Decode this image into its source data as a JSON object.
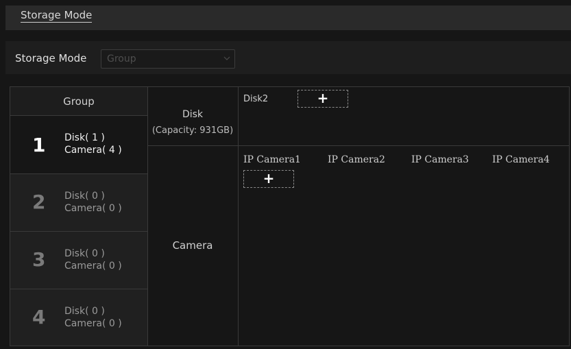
{
  "tab": {
    "label": "Storage Mode"
  },
  "storage_mode": {
    "label": "Storage Mode",
    "value": "Group"
  },
  "group_header": "Group",
  "groups": [
    {
      "number": "1",
      "disk": "Disk( 1 )",
      "camera": "Camera( 4 )"
    },
    {
      "number": "2",
      "disk": "Disk( 0 )",
      "camera": "Camera( 0 )"
    },
    {
      "number": "3",
      "disk": "Disk( 0 )",
      "camera": "Camera( 0 )"
    },
    {
      "number": "4",
      "disk": "Disk( 0 )",
      "camera": "Camera( 0 )"
    }
  ],
  "disk_section": {
    "title": "Disk",
    "capacity": "(Capacity: 931GB)",
    "disks": [
      "Disk2"
    ],
    "add_symbol": "+"
  },
  "camera_section": {
    "title": "Camera",
    "cameras": [
      "IP Camera1",
      "IP Camera2",
      "IP Camera3",
      "IP Camera4"
    ],
    "add_symbol": "+"
  },
  "colors": {
    "background": "#161616",
    "border": "#3a3a3a",
    "active_text": "#ffffff"
  },
  "icons": {
    "dropdown": "chevron-down-icon",
    "add": "plus-icon"
  }
}
